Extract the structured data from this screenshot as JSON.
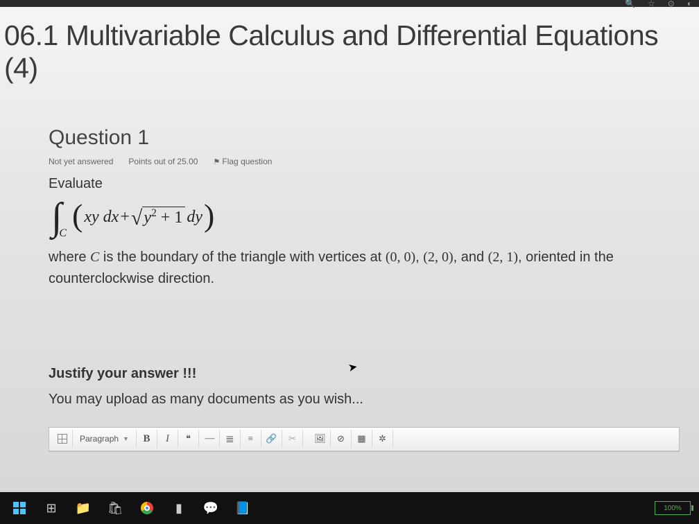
{
  "browser": {
    "icons": [
      "🔍",
      "☆",
      "⟳",
      "◐"
    ]
  },
  "page": {
    "title": "06.1 Multivariable Calculus and Differential Equations (4)"
  },
  "question": {
    "heading": "Question 1",
    "status": "Not yet answered",
    "points": "Points out of 25.00",
    "flag": "Flag question",
    "prompt": "Evaluate",
    "math": {
      "integral_sub": "C",
      "term1": "xy dx",
      "plus": " + ",
      "sqrt_arg_head": "y",
      "sqrt_arg_exp": "2",
      "sqrt_arg_tail": " + 1",
      "term2_tail": " dy"
    },
    "where_pre": "where ",
    "where_c": "C",
    "where_mid": " is the boundary of the triangle with vertices at ",
    "v1": "(0, 0)",
    "sep1": ", ",
    "v2": "(2, 0)",
    "sep2": ", and ",
    "v3": "(2, 1)",
    "where_post": ", oriented in the counterclockwise direction.",
    "justify": "Justify your answer !!!",
    "upload_note": "You may upload as many documents as you wish..."
  },
  "editor": {
    "paragraph": "Paragraph",
    "bold": "B",
    "italic": "I",
    "ol": "⋮≡",
    "ul2": "≡",
    "link": "🔗",
    "unlink": "�руп",
    "img": "🖼",
    "no": "⊘",
    "media": "▦",
    "more": "✲"
  },
  "taskbar": {
    "battery": "100%"
  }
}
